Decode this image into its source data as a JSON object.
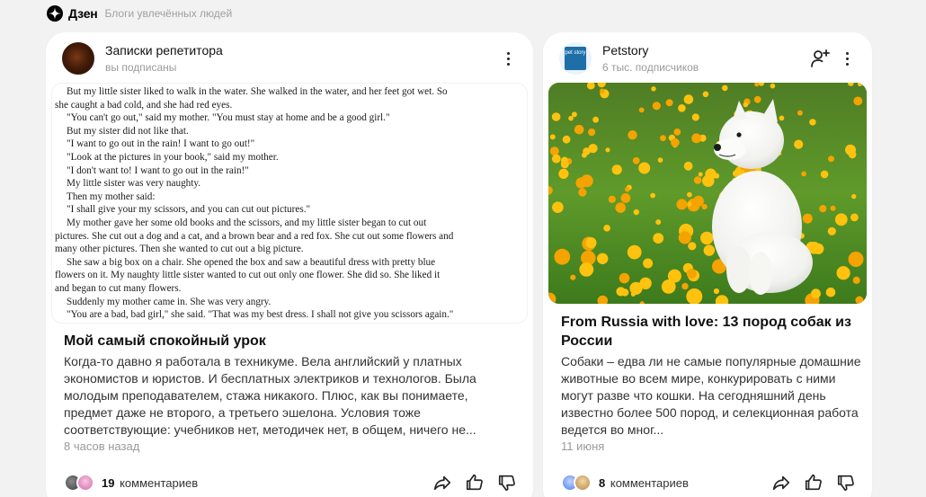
{
  "header": {
    "brand": "Дзен",
    "tagline": "Блоги увлечённых людей"
  },
  "cards": [
    {
      "channel": "Записки репетитора",
      "subtitle": "вы подписаны",
      "excerpt_lines": [
        {
          "t": "But my little sister liked to walk in the water. She walked in the water, and her feet got wet. So",
          "ind": true
        },
        {
          "t": "she caught a bad cold, and she had red eyes.",
          "ind": false
        },
        {
          "t": "\"You can't go out,\" said my mother. \"You must stay at home and be a good girl.\"",
          "ind": true
        },
        {
          "t": "But my sister did not like that.",
          "ind": true
        },
        {
          "t": "\"I want to go out in the rain! I want to go out!\"",
          "ind": true
        },
        {
          "t": "\"Look at the pictures in your book,\" said my mother.",
          "ind": true
        },
        {
          "t": "\"I don't want to! I want to go out in the rain!\"",
          "ind": true
        },
        {
          "t": "My little sister was very naughty.",
          "ind": true
        },
        {
          "t": "Then my mother said:",
          "ind": true
        },
        {
          "t": "\"I shall give your my scissors, and you can cut out pictures.\"",
          "ind": true
        },
        {
          "t": "My mother gave her some old books and the scissors, and my little sister began to cut out",
          "ind": true
        },
        {
          "t": "pictures. She cut out a dog and a cat, and a brown bear and a red fox. She cut out some flowers and",
          "ind": false
        },
        {
          "t": "many other pictures. Then she wanted to cut out a big picture.",
          "ind": false
        },
        {
          "t": "She saw a big box on a chair. She opened the box and saw a beautiful dress with pretty blue",
          "ind": true
        },
        {
          "t": "flowers on it. My naughty little sister wanted to cut out only one flower. She did so. She liked it",
          "ind": false
        },
        {
          "t": "and began to cut many flowers.",
          "ind": false
        },
        {
          "t": "Suddenly my mother came in. She was very angry.",
          "ind": true
        },
        {
          "t": "\"You are a bad, bad girl,\" she said. \"That was my best dress. I shall not give you scissors again.\"",
          "ind": true
        }
      ],
      "title": "Мой самый спокойный урок",
      "body": "Когда-то давно я работала в техникуме. Вела английский у платных экономистов и юристов. И бесплатных электриков и технологов. Была молодым преподавателем, стажа никакого. Плюс, как вы понимаете, предмет даже не второго, а третьего эшелона. Условия тоже соответствующие: учебников нет, методичек нет, в общем, ничего не...",
      "date": "8 часов назад",
      "comments_count": "19",
      "comments_label": "комментариев"
    },
    {
      "channel": "Petstory",
      "subtitle": "6 тыс. подписчиков",
      "logo_text": "pet story",
      "title": "From Russia with love: 13 пород собак из России",
      "body": "Собаки – едва ли не самые популярные домашние животные во всем мире, конкурировать с ними могут разве что кошки. На сегодняшний день известно более 500 пород, и селекционная работа ведется во мног...",
      "date": "11 июня",
      "comments_count": "8",
      "comments_label": "комментариев"
    }
  ],
  "colors": {
    "background": "#f2f2f2",
    "card": "#ffffff",
    "muted": "#9a9a9a"
  }
}
